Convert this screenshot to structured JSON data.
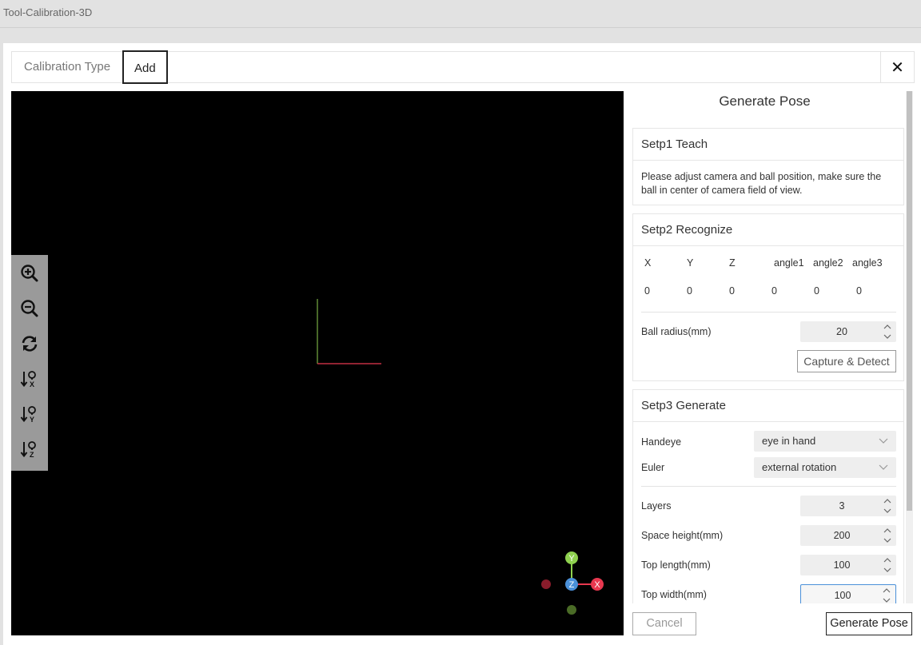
{
  "window": {
    "title": "Tool-Calibration-3D"
  },
  "tabs": {
    "calibration_type": "Calibration Type",
    "add": "Add"
  },
  "close_label": "✕",
  "toolbar": {
    "items": [
      "zoom-in",
      "zoom-out",
      "reset-view",
      "view-x",
      "view-y",
      "view-z"
    ]
  },
  "axis_gizmo": {
    "y": "Y",
    "z": "Z",
    "x": "X"
  },
  "panel": {
    "title": "Generate Pose",
    "step1": {
      "title": "Setp1 Teach",
      "description": "Please adjust camera and ball position, make sure the ball in center of camera field of view."
    },
    "step2": {
      "title": "Setp2 Recognize",
      "headers": [
        "X",
        "Y",
        "Z",
        "angle1",
        "angle2",
        "angle3"
      ],
      "values": [
        "0",
        "0",
        "0",
        "0",
        "0",
        "0"
      ],
      "ball_radius_label": "Ball radius(mm)",
      "ball_radius_value": "20",
      "capture_button": "Capture & Detect"
    },
    "step3": {
      "title": "Setp3 Generate",
      "handeye_label": "Handeye",
      "handeye_value": "eye in hand",
      "euler_label": "Euler",
      "euler_value": "external rotation",
      "layers_label": "Layers",
      "layers_value": "3",
      "space_height_label": "Space height(mm)",
      "space_height_value": "200",
      "top_length_label": "Top length(mm)",
      "top_length_value": "100",
      "top_width_label": "Top width(mm)",
      "top_width_value": "100"
    }
  },
  "footer": {
    "cancel": "Cancel",
    "generate": "Generate Pose"
  },
  "colors": {
    "axis_x": "#e8384f",
    "axis_y": "#8fd14f",
    "axis_z": "#4a90d9",
    "viewport_bg": "#000000",
    "toolbar_bg": "#9a9a9a"
  }
}
